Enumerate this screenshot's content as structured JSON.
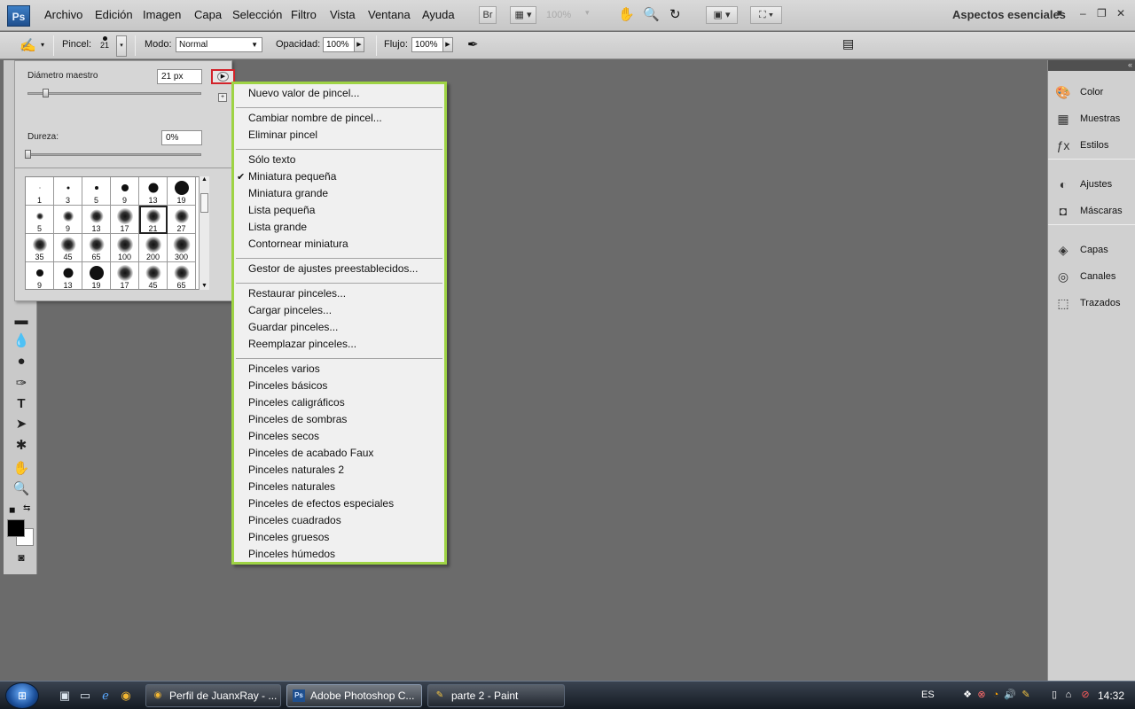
{
  "menubar": {
    "logo": "Ps",
    "items": [
      "Archivo",
      "Edición",
      "Imagen",
      "Capa",
      "Selección",
      "Filtro",
      "Vista",
      "Ventana",
      "Ayuda"
    ],
    "bridge_button": "Br",
    "zoom": "100%",
    "workspace": "Aspectos esenciales"
  },
  "options": {
    "brush_label": "Pincel:",
    "brush_size": "21",
    "mode_label": "Modo:",
    "mode_value": "Normal",
    "opacity_label": "Opacidad:",
    "opacity_value": "100%",
    "flow_label": "Flujo:",
    "flow_value": "100%"
  },
  "brush_panel": {
    "diameter_label": "Diámetro maestro",
    "diameter_value": "21 px",
    "hardness_label": "Dureza:",
    "hardness_value": "0%",
    "diameter_level": 0.1,
    "hardness_level": 0.0,
    "presets": [
      {
        "size": "1",
        "soft": false
      },
      {
        "size": "3",
        "soft": false
      },
      {
        "size": "5",
        "soft": false
      },
      {
        "size": "9",
        "soft": false
      },
      {
        "size": "13",
        "soft": false
      },
      {
        "size": "19",
        "soft": false
      },
      {
        "size": "5",
        "soft": true
      },
      {
        "size": "9",
        "soft": true
      },
      {
        "size": "13",
        "soft": true
      },
      {
        "size": "17",
        "soft": true
      },
      {
        "size": "21",
        "soft": true
      },
      {
        "size": "27",
        "soft": true
      },
      {
        "size": "35",
        "soft": true
      },
      {
        "size": "45",
        "soft": true
      },
      {
        "size": "65",
        "soft": true
      },
      {
        "size": "100",
        "soft": true
      },
      {
        "size": "200",
        "soft": true
      },
      {
        "size": "300",
        "soft": true
      },
      {
        "size": "9",
        "soft": false
      },
      {
        "size": "13",
        "soft": false
      },
      {
        "size": "19",
        "soft": false
      },
      {
        "size": "17",
        "soft": true
      },
      {
        "size": "45",
        "soft": true
      },
      {
        "size": "65",
        "soft": true
      }
    ]
  },
  "context_menu": {
    "groups": [
      [
        "Nuevo valor de pincel..."
      ],
      [
        "Cambiar nombre de pincel...",
        "Eliminar pincel"
      ],
      [
        "Sólo texto",
        "Miniatura pequeña",
        "Miniatura grande",
        "Lista pequeña",
        "Lista grande",
        "Contornear miniatura"
      ],
      [
        "Gestor de ajustes preestablecidos..."
      ],
      [
        "Restaurar pinceles...",
        "Cargar pinceles...",
        "Guardar pinceles...",
        "Reemplazar pinceles..."
      ],
      [
        "Pinceles varios",
        "Pinceles básicos",
        "Pinceles caligráficos",
        "Pinceles de sombras",
        "Pinceles secos",
        "Pinceles de acabado Faux",
        "Pinceles naturales 2",
        "Pinceles naturales",
        "Pinceles de efectos especiales",
        "Pinceles cuadrados",
        "Pinceles gruesos",
        "Pinceles húmedos"
      ]
    ],
    "checked": "Miniatura pequeña"
  },
  "dock": {
    "groups": [
      [
        {
          "label": "Color",
          "icon": "palette-icon"
        },
        {
          "label": "Muestras",
          "icon": "swatches-icon"
        },
        {
          "label": "Estilos",
          "icon": "styles-icon"
        }
      ],
      [
        {
          "label": "Ajustes",
          "icon": "adjustments-icon"
        },
        {
          "label": "Máscaras",
          "icon": "masks-icon"
        }
      ],
      [
        {
          "label": "Capas",
          "icon": "layers-icon"
        },
        {
          "label": "Canales",
          "icon": "channels-icon"
        },
        {
          "label": "Trazados",
          "icon": "paths-icon"
        }
      ]
    ]
  },
  "taskbar": {
    "tasks": [
      "Perfil de JuanxRay - ...",
      "Adobe Photoshop C...",
      "parte 2 - Paint"
    ],
    "language": "ES",
    "clock": "14:32"
  }
}
